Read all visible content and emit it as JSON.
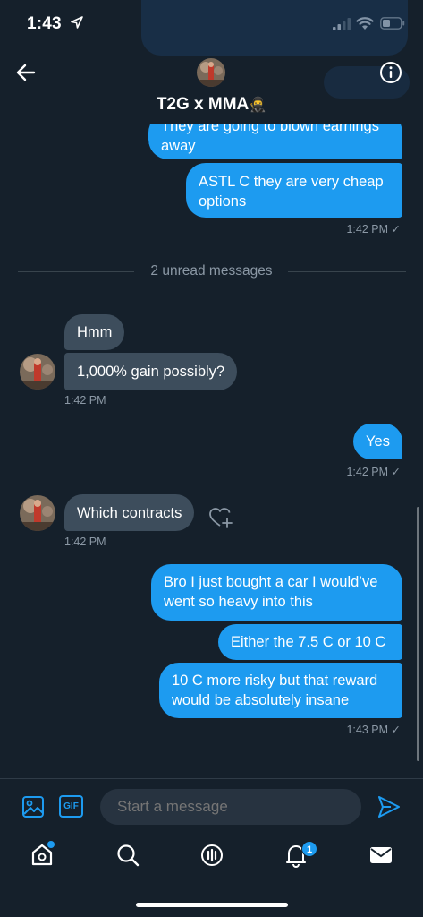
{
  "status_bar": {
    "time": "1:43"
  },
  "header": {
    "title": "T2G x MMA",
    "title_emoji": "🥷"
  },
  "messages": [
    {
      "id": "m1",
      "direction": "out",
      "lines": "They are going to blown earnings away"
    },
    {
      "id": "m2",
      "direction": "out",
      "lines": "ASTL C they are very cheap options"
    },
    {
      "id": "m3",
      "direction": "in",
      "lines": "Hmm"
    },
    {
      "id": "m4",
      "direction": "in",
      "lines": "1,000% gain possibly?"
    },
    {
      "id": "m5",
      "direction": "out",
      "lines": "Yes"
    },
    {
      "id": "m6",
      "direction": "in",
      "lines": "Which contracts"
    },
    {
      "id": "m7",
      "direction": "out",
      "lines": "Bro I just bought a car I would've went so heavy into this"
    },
    {
      "id": "m8",
      "direction": "out",
      "lines": "Either the 7.5 C or 10 C"
    },
    {
      "id": "m9",
      "direction": "out",
      "lines": "10 C more risky but that reward would be absolutely insane"
    }
  ],
  "bubbles": {
    "m1_l1": "They are going to blown earnings",
    "m1_l2": "away",
    "m2_l1": "ASTL C they are very cheap",
    "m2_l2": "options",
    "m3": "Hmm",
    "m4": "1,000% gain possibly?",
    "m5": "Yes",
    "m6": "Which contracts",
    "m7_l1": "Bro I just bought a car I would’ve",
    "m7_l2": "went so heavy into this",
    "m8": "Either the 7.5 C or 10 C",
    "m9_l1": "10 C more risky but that reward",
    "m9_l2": "would be absolutely insane"
  },
  "timestamps": {
    "t1": "1:42 PM",
    "t2": "1:42 PM",
    "t3": "1:42 PM",
    "t4": "1:42 PM",
    "t5": "1:43 PM"
  },
  "read_check": "✓",
  "divider": {
    "text": "2 unread messages"
  },
  "composer": {
    "placeholder": "Start a message",
    "gif_label": "GIF"
  },
  "tabbar": {
    "notifications_count": "1"
  },
  "colors": {
    "background": "#15202b",
    "accent": "#1d9bf0",
    "incoming_bubble": "#3d4d5c",
    "muted_text": "#8b98a5"
  }
}
